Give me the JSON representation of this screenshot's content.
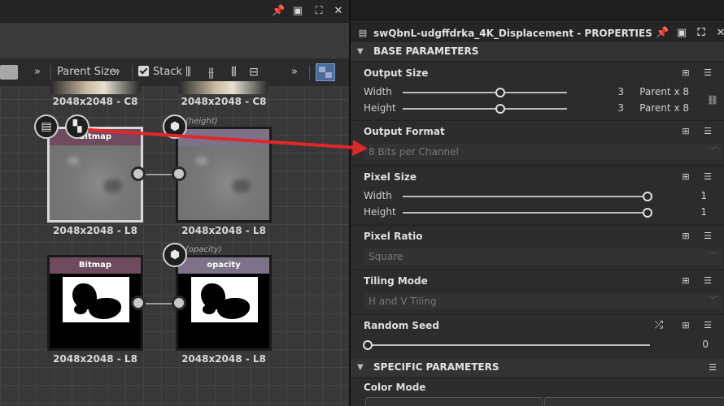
{
  "graph": {
    "toolbar": {
      "overflow_left": "»",
      "parent_size_label": "Parent Size:",
      "parent_size_overflow": "»",
      "stack_label": "Stack",
      "overflow_right": "»"
    },
    "top_labels": [
      "2048x2048 - C8",
      "2048x2048 - C8"
    ],
    "nodes": [
      {
        "title": "Bitmap",
        "label": "2048x2048 - L8",
        "selected": true
      },
      {
        "title": "",
        "label": "2048x2048 - L8",
        "param": "(height)"
      },
      {
        "title": "Bitmap",
        "label": "2048x2048 - L8"
      },
      {
        "title": "opacity",
        "label": "2048x2048 - L8",
        "param": "(opacity)"
      }
    ]
  },
  "properties": {
    "title": "swQbnL-udgffdrka_4K_Displacement - PROPERTIES",
    "base_section": "BASE PARAMETERS",
    "output_size": {
      "title": "Output Size",
      "width_label": "Width",
      "width_value": "3",
      "width_relative": "Parent x 8",
      "height_label": "Height",
      "height_value": "3",
      "height_relative": "Parent x 8",
      "slider_fraction": 0.6
    },
    "output_format": {
      "title": "Output Format",
      "value": "8 Bits per Channel"
    },
    "pixel_size": {
      "title": "Pixel Size",
      "width_label": "Width",
      "width_value": "1",
      "height_label": "Height",
      "height_value": "1",
      "slider_fraction": 1.0
    },
    "pixel_ratio": {
      "title": "Pixel Ratio",
      "value": "Square"
    },
    "tiling_mode": {
      "title": "Tiling Mode",
      "value": "H and V Tiling"
    },
    "random_seed": {
      "title": "Random Seed",
      "value": "0",
      "slider_fraction": 0.0
    },
    "specific_section": "SPECIFIC PARAMETERS",
    "color_mode": {
      "title": "Color Mode"
    }
  },
  "accent_colors": {
    "arrow": "#e0282a",
    "node_header": "#6e4b5e",
    "node_header_b": "#7d7288"
  }
}
